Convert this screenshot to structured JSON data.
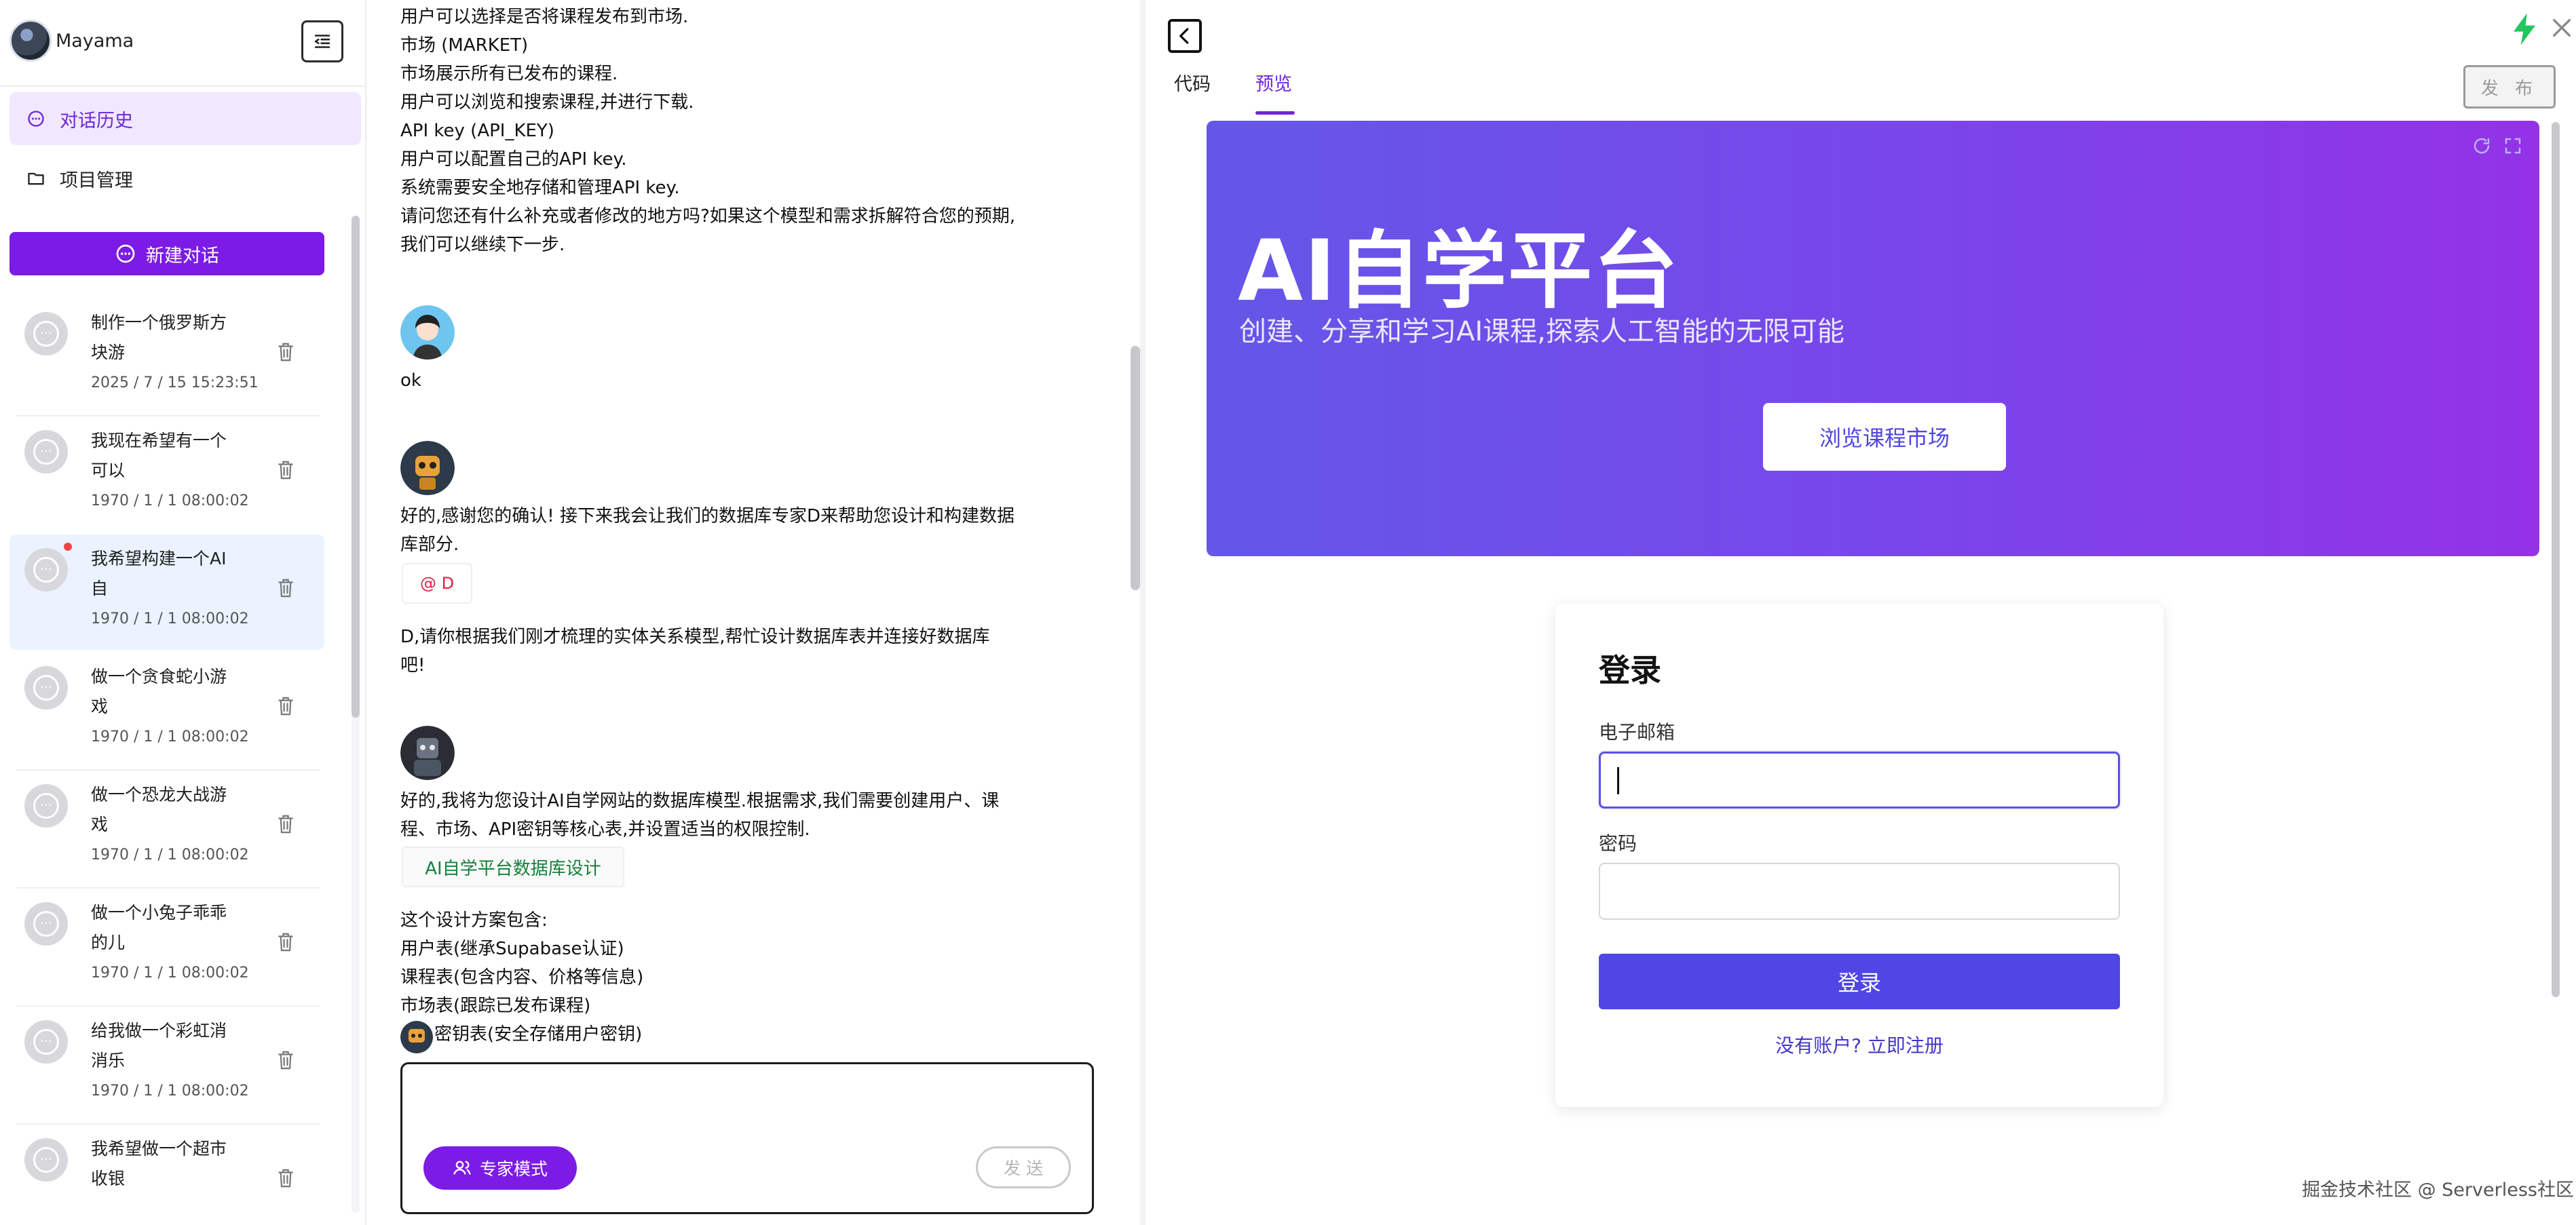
{
  "sidebar": {
    "user_name": "Mayama",
    "nav": [
      {
        "label": "对话历史",
        "icon": "chat-bubble-icon",
        "active": true
      },
      {
        "label": "项目管理",
        "icon": "folder-icon",
        "active": false
      }
    ],
    "new_chat_label": "新建对话",
    "conversations": [
      {
        "title": "制作一个俄罗斯方块游",
        "time": "2025 / 7 / 15 15:23:51",
        "selected": false
      },
      {
        "title": "我现在希望有一个可以",
        "time": "1970 / 1 / 1 08:00:02",
        "selected": false
      },
      {
        "title": "我希望构建一个AI自",
        "time": "1970 / 1 / 1 08:00:02",
        "selected": true,
        "unread": true
      },
      {
        "title": "做一个贪食蛇小游戏",
        "time": "1970 / 1 / 1 08:00:02",
        "selected": false
      },
      {
        "title": "做一个恐龙大战游戏",
        "time": "1970 / 1 / 1 08:00:02",
        "selected": false
      },
      {
        "title": "做一个小兔子乖乖的儿",
        "time": "1970 / 1 / 1 08:00:02",
        "selected": false
      },
      {
        "title": "给我做一个彩虹消消乐",
        "time": "1970 / 1 / 1 08:00:02",
        "selected": false
      },
      {
        "title": "我希望做一个超市收银",
        "time": "",
        "selected": false
      }
    ]
  },
  "chat": {
    "intro_lines": [
      "用户可以选择是否将课程发布到市场.",
      "市场 (MARKET)",
      "市场展示所有已发布的课程.",
      "用户可以浏览和搜索课程,并进行下载.",
      "API key (API_KEY)",
      "用户可以配置自己的API key.",
      "系统需要安全地存储和管理API key.",
      "请问您还有什么补充或者修改的地方吗?如果这个模型和需求拆解符合您的预期,",
      "我们可以继续下一步."
    ],
    "user_reply": "ok",
    "agent1_lines": [
      "好的,感谢您的确认! 接下来我会让我们的数据库专家D来帮助您设计和构建数据",
      "库部分."
    ],
    "mention": "@ D",
    "agent1_request_lines": [
      "D,请你根据我们刚才梳理的实体关系模型,帮忙设计数据库表并连接好数据库",
      "吧!"
    ],
    "agent2_lines": [
      "好的,我将为您设计AI自学网站的数据库模型.根据需求,我们需要创建用户、课",
      "程、市场、API密钥等核心表,并设置适当的权限控制."
    ],
    "artifact_label": "AI自学平台数据库设计",
    "summary_lines": [
      "这个设计方案包含:",
      "用户表(继承Supabase认证)",
      "课程表(包含内容、价格等信息)",
      "市场表(跟踪已发布课程)",
      "密钥表(安全存储用户密钥)"
    ],
    "expert_mode_label": "专家模式",
    "send_label": "发 送"
  },
  "preview": {
    "tabs": [
      {
        "label": "代码",
        "active": false
      },
      {
        "label": "预览",
        "active": true
      }
    ],
    "publish_label": "发 布",
    "hero": {
      "title": "AI自学平台",
      "subtitle": "创建、分享和学习AI课程,探索人工智能的无限可能",
      "cta": "浏览课程市场"
    },
    "login": {
      "title": "登录",
      "email_label": "电子邮箱",
      "email_value": "",
      "password_label": "密码",
      "password_value": "",
      "submit_label": "登录",
      "register_link": "没有账户? 立即注册"
    },
    "watermark": "掘金技术社区 @ Serverless社区"
  },
  "colors": {
    "brand_purple": "#7c1be6",
    "active_tab": "#6d28d9",
    "login_button": "#4f46e5",
    "hero_gradient_start": "#6457e8",
    "hero_gradient_end": "#9432e8",
    "artifact_green": "#15803d",
    "mention_red": "#e11d48"
  }
}
